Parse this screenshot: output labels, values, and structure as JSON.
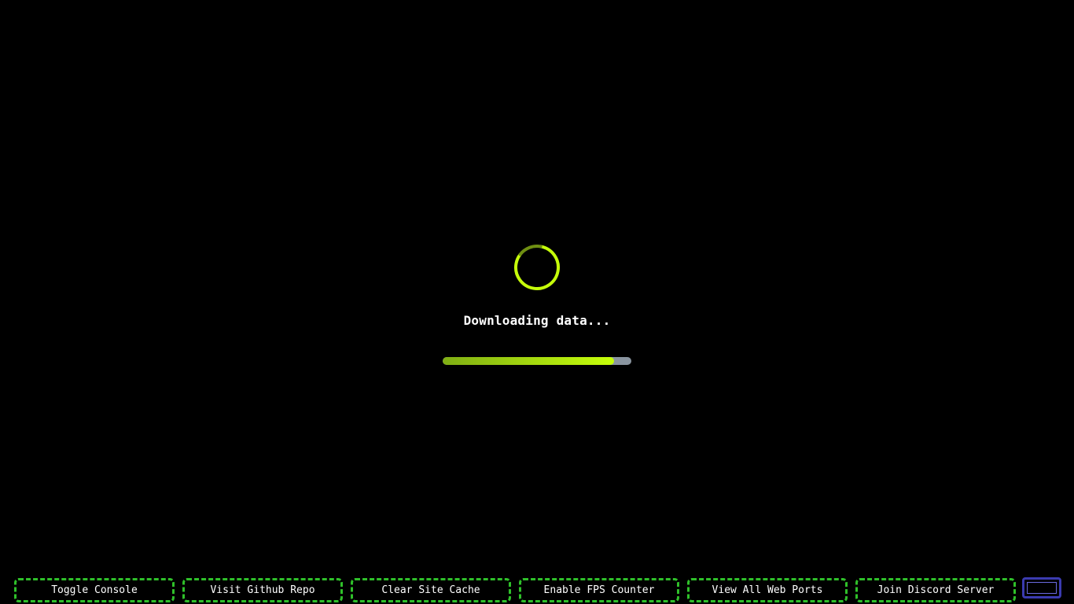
{
  "loader": {
    "status_text": "Downloading data...",
    "progress_fraction": 0.91,
    "accent_color": "#c6ff0a",
    "track_color": "#8a95a0"
  },
  "toolbar": {
    "border_color": "#2fc02a",
    "buttons": [
      {
        "label": "Toggle Console"
      },
      {
        "label": "Visit Github Repo"
      },
      {
        "label": "Clear Site Cache"
      },
      {
        "label": "Enable FPS Counter"
      },
      {
        "label": "View All Web Ports"
      },
      {
        "label": "Join Discord Server"
      }
    ],
    "extra_button_color": "#3b3bb0"
  }
}
